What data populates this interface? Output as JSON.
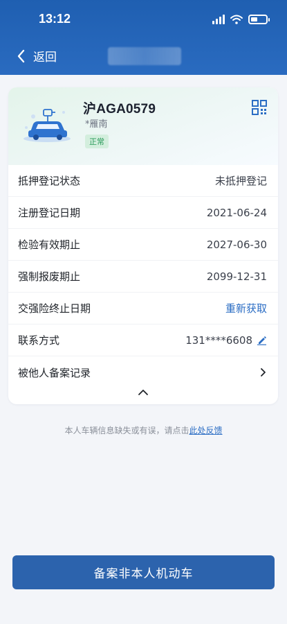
{
  "status_bar": {
    "time": "13:12"
  },
  "header": {
    "back_label": "返回"
  },
  "vehicle": {
    "plate": "沪AGA0579",
    "model": "*雁南",
    "status_badge": "正常"
  },
  "details": [
    {
      "label": "抵押登记状态",
      "value": "未抵押登记"
    },
    {
      "label": "注册登记日期",
      "value": "2021-06-24"
    },
    {
      "label": "检验有效期止",
      "value": "2027-06-30"
    },
    {
      "label": "强制报废期止",
      "value": "2099-12-31"
    },
    {
      "label": "交强险终止日期",
      "value": "重新获取"
    },
    {
      "label": "联系方式",
      "value": "131****6608"
    },
    {
      "label": "被他人备案记录",
      "value": ""
    }
  ],
  "feedback": {
    "text": "本人车辆信息缺失或有误，请点击",
    "link": "此处反馈"
  },
  "bottom_button": "备案非本人机动车",
  "colors": {
    "header_blue": "#2a6bc0",
    "link_blue": "#2b6dc4",
    "badge_green": "#2a9b5a",
    "button_blue": "#2c63ad"
  }
}
